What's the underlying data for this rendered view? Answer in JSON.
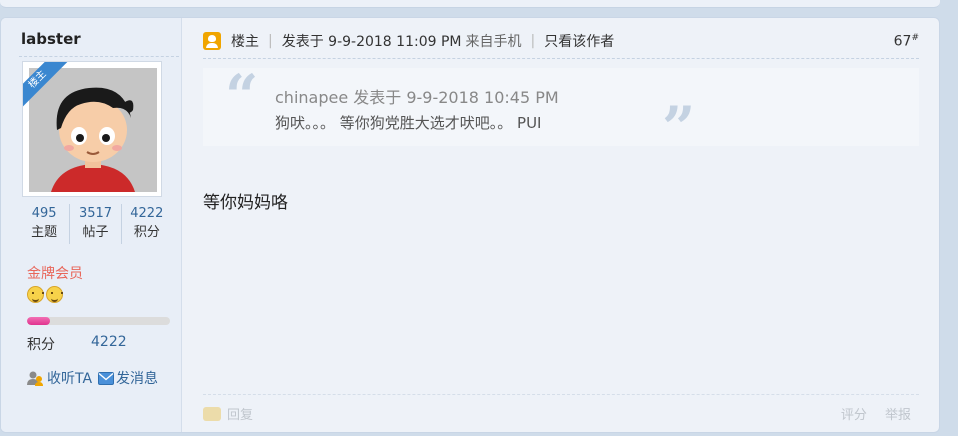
{
  "colors": {
    "page_bg": "#cfdcea",
    "panel_bg": "#eef2f8",
    "sidebar_bg": "#e8eef7",
    "link": "#336699",
    "rank_text": "#e8665a",
    "progress_fill": "#e0328f",
    "owner_badge": "#f0a500",
    "ribbon": "#3a87d0"
  },
  "author": {
    "username": "labster",
    "badge": "楼主",
    "stats": [
      {
        "value": "495",
        "label": "主题"
      },
      {
        "value": "3517",
        "label": "帖子"
      },
      {
        "value": "4222",
        "label": "积分"
      }
    ],
    "rank": "金牌会员",
    "rank_icons": [
      "smiley-icon",
      "smiley-icon"
    ],
    "progress_fraction": 0.16,
    "score_label": "积分",
    "score_value": "4222",
    "follow_label": "收听TA",
    "message_label": "发消息"
  },
  "post": {
    "owner_label": "楼主",
    "posted_at": "发表于 9-9-2018 11:09 PM",
    "source": "来自手机",
    "only_author": "只看该作者",
    "floor_number": "67",
    "floor_mark": "#",
    "quote": {
      "header": "chinapee 发表于 9-9-2018 10:45 PM",
      "text": "狗吠。。。  等你狗党胜大选才吠吧。。 PUI"
    },
    "body": "等你妈妈咯",
    "reply_label": "回复",
    "rate_label": "评分",
    "report_label": "举报"
  }
}
